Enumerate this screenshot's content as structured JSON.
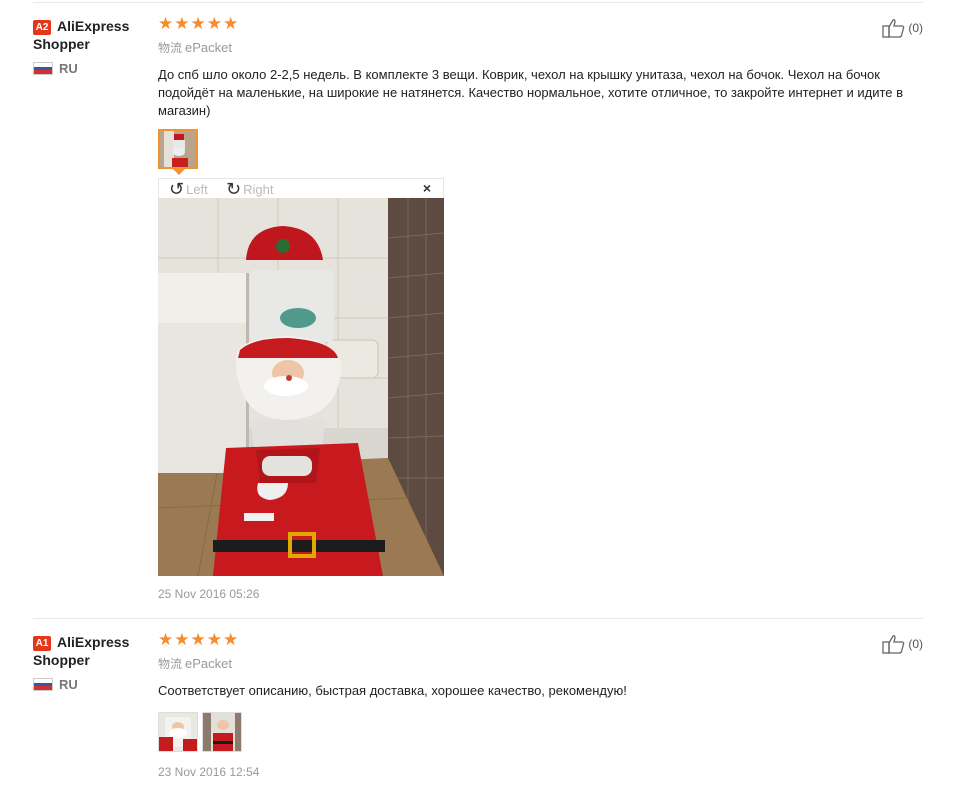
{
  "reviews": [
    {
      "level": "A2",
      "user_name_first": "AliExpress",
      "user_name_second": "Shopper",
      "country": "RU",
      "stars": "★★★★★",
      "logistics_label": "物流",
      "logistics_value": "ePacket",
      "text": "До спб шло около 2-2,5 недель. В комплекте 3 вещи. Коврик, чехол на крышку унитаза, чехол на бочок. Чехол на бочок подойдёт на маленькие, на широкие не натянется. Качество нормальное, хотите отличное, то закройте интернет и идите в магазин)",
      "helpful_count": "(0)",
      "date": "25 Nov 2016 05:26",
      "viewer": {
        "rotate_left_label": "Left",
        "rotate_right_label": "Right",
        "close_icon": "×"
      }
    },
    {
      "level": "A1",
      "user_name_first": "AliExpress",
      "user_name_second": "Shopper",
      "country": "RU",
      "stars": "★★★★★",
      "logistics_label": "物流",
      "logistics_value": "ePacket",
      "text": "Соответствует описанию, быстрая доставка, хорошее качество, рекомендую!",
      "helpful_count": "(0)",
      "date": "23 Nov 2016 12:54"
    }
  ],
  "colors": {
    "star": "#f78c28",
    "badge": "#e4361a",
    "selected_thumb": "#f09332"
  },
  "icons": [
    "thumbs-up-icon",
    "rotate-left-icon",
    "rotate-right-icon",
    "close-icon",
    "russia-flag-icon"
  ]
}
